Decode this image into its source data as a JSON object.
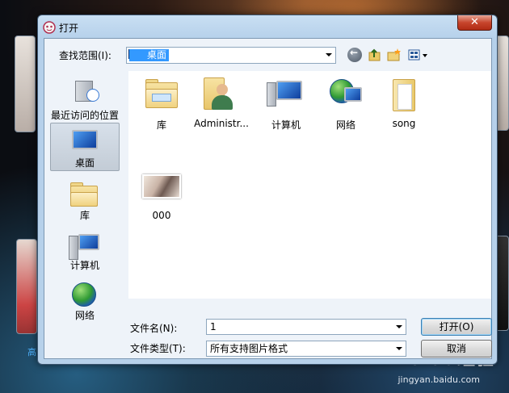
{
  "dialog": {
    "title": "打开",
    "close_label": "✕"
  },
  "toolbar": {
    "lookin_label": "查找范围(I):",
    "lookin_value": "桌面"
  },
  "places": [
    {
      "label": "最近访问的位置",
      "icon": "recent-places-icon"
    },
    {
      "label": "桌面",
      "icon": "desktop-icon",
      "selected": true
    },
    {
      "label": "库",
      "icon": "library-icon"
    },
    {
      "label": "计算机",
      "icon": "computer-icon"
    },
    {
      "label": "网络",
      "icon": "network-icon"
    }
  ],
  "files": [
    {
      "label": "库",
      "icon": "library-folder-icon"
    },
    {
      "label": "Administr...",
      "icon": "user-folder-icon"
    },
    {
      "label": "计算机",
      "icon": "computer-icon"
    },
    {
      "label": "网络",
      "icon": "network-icon"
    },
    {
      "label": "song",
      "icon": "folder-icon"
    },
    {
      "label": "000",
      "icon": "image-thumbnail-icon"
    }
  ],
  "bottom": {
    "filename_label": "文件名(N):",
    "filename_value": "1",
    "filetype_label": "文件类型(T):",
    "filetype_value": "所有支持图片格式",
    "open_label": "打开(O)",
    "cancel_label": "取消"
  },
  "watermark": {
    "brand": "Baidu经验",
    "url": "jingyan.baidu.com"
  }
}
